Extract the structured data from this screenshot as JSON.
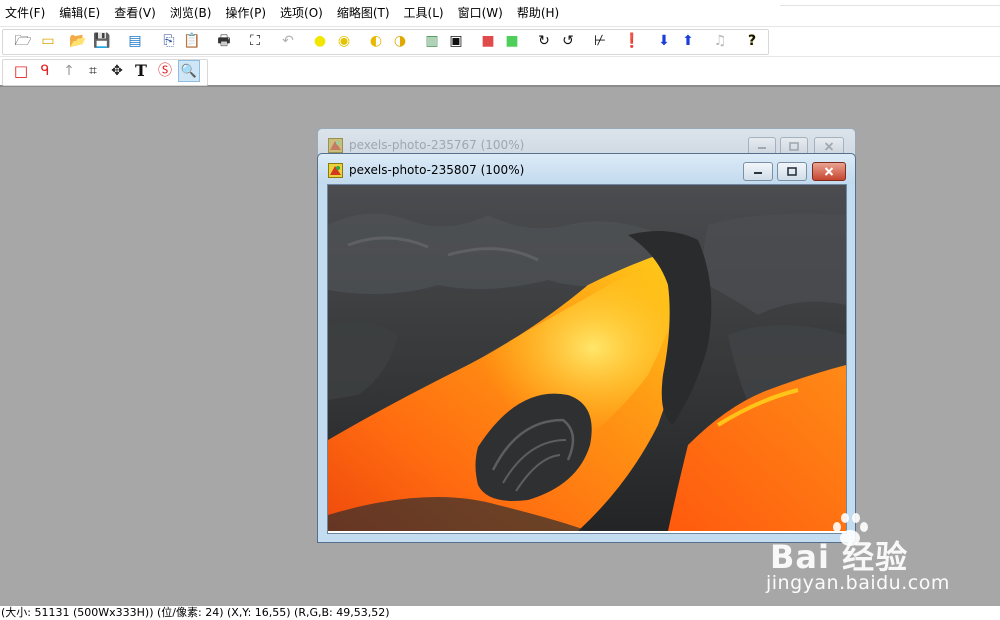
{
  "menubar": {
    "items": [
      "文件(F)",
      "编辑(E)",
      "查看(V)",
      "浏览(B)",
      "操作(P)",
      "选项(O)",
      "缩略图(T)",
      "工具(L)",
      "窗口(W)",
      "帮助(H)"
    ]
  },
  "toolbar_main": {
    "buttons": [
      {
        "name": "open-folder-icon",
        "glyph": "🗁"
      },
      {
        "name": "new-icon",
        "glyph": "▭"
      },
      {
        "name": "open-icon",
        "glyph": "📂"
      },
      {
        "name": "save-icon",
        "glyph": "💾"
      },
      {
        "name": "scan-icon",
        "glyph": "▤"
      },
      {
        "name": "copy-icon",
        "glyph": "⎘"
      },
      {
        "name": "paste-icon",
        "glyph": "📋"
      },
      {
        "name": "print-icon",
        "glyph": "🖶"
      },
      {
        "name": "fullscreen-icon",
        "glyph": "⛶"
      },
      {
        "name": "undo-icon",
        "glyph": "↶"
      },
      {
        "name": "brightness-up-icon",
        "glyph": "●"
      },
      {
        "name": "brightness-down-icon",
        "glyph": "◉"
      },
      {
        "name": "contrast-up-icon",
        "glyph": "◐"
      },
      {
        "name": "contrast-down-icon",
        "glyph": "◑"
      },
      {
        "name": "color-icon",
        "glyph": "▥"
      },
      {
        "name": "border-icon",
        "glyph": "▣"
      },
      {
        "name": "red-icon",
        "glyph": "■"
      },
      {
        "name": "green-icon",
        "glyph": "■"
      },
      {
        "name": "rotate-right-icon",
        "glyph": "↻"
      },
      {
        "name": "rotate-left-icon",
        "glyph": "↺"
      },
      {
        "name": "histogram-icon",
        "glyph": "⊬"
      },
      {
        "name": "info-icon",
        "glyph": "❗"
      },
      {
        "name": "down-arrow-icon",
        "glyph": "⬇"
      },
      {
        "name": "up-arrow-icon",
        "glyph": "⬆"
      },
      {
        "name": "sound-icon",
        "glyph": "♫"
      },
      {
        "name": "help-icon",
        "glyph": "?"
      }
    ]
  },
  "toolbar_select": {
    "buttons": [
      {
        "name": "rectangle-select-icon",
        "glyph": "□"
      },
      {
        "name": "lasso-select-icon",
        "glyph": "ᑫ"
      },
      {
        "name": "arrow-tool-icon",
        "glyph": "↑"
      },
      {
        "name": "crop-tool-icon",
        "glyph": "⌗"
      },
      {
        "name": "move-tool-icon",
        "glyph": "✥"
      },
      {
        "name": "text-tool-icon",
        "glyph": "T"
      },
      {
        "name": "stamp-tool-icon",
        "glyph": "Ⓢ"
      },
      {
        "name": "zoom-tool-icon",
        "glyph": "🔍"
      }
    ]
  },
  "windows": {
    "back_title": "pexels-photo-235767 (100%)",
    "front_title": "pexels-photo-235807 (100%)"
  },
  "status": {
    "text": "(大小: 51131 (500Wx333H)) (位/像素: 24) (X,Y: 16,55) (R,G,B: 49,53,52)"
  },
  "watermark": {
    "brand": "Bai 经验",
    "url": "jingyan.baidu.com"
  },
  "colors": {
    "desktop": "#a7a7a7",
    "lava_bright": "#ffd21a",
    "lava_mid": "#ff7a12",
    "rock": "#2e2f31"
  }
}
